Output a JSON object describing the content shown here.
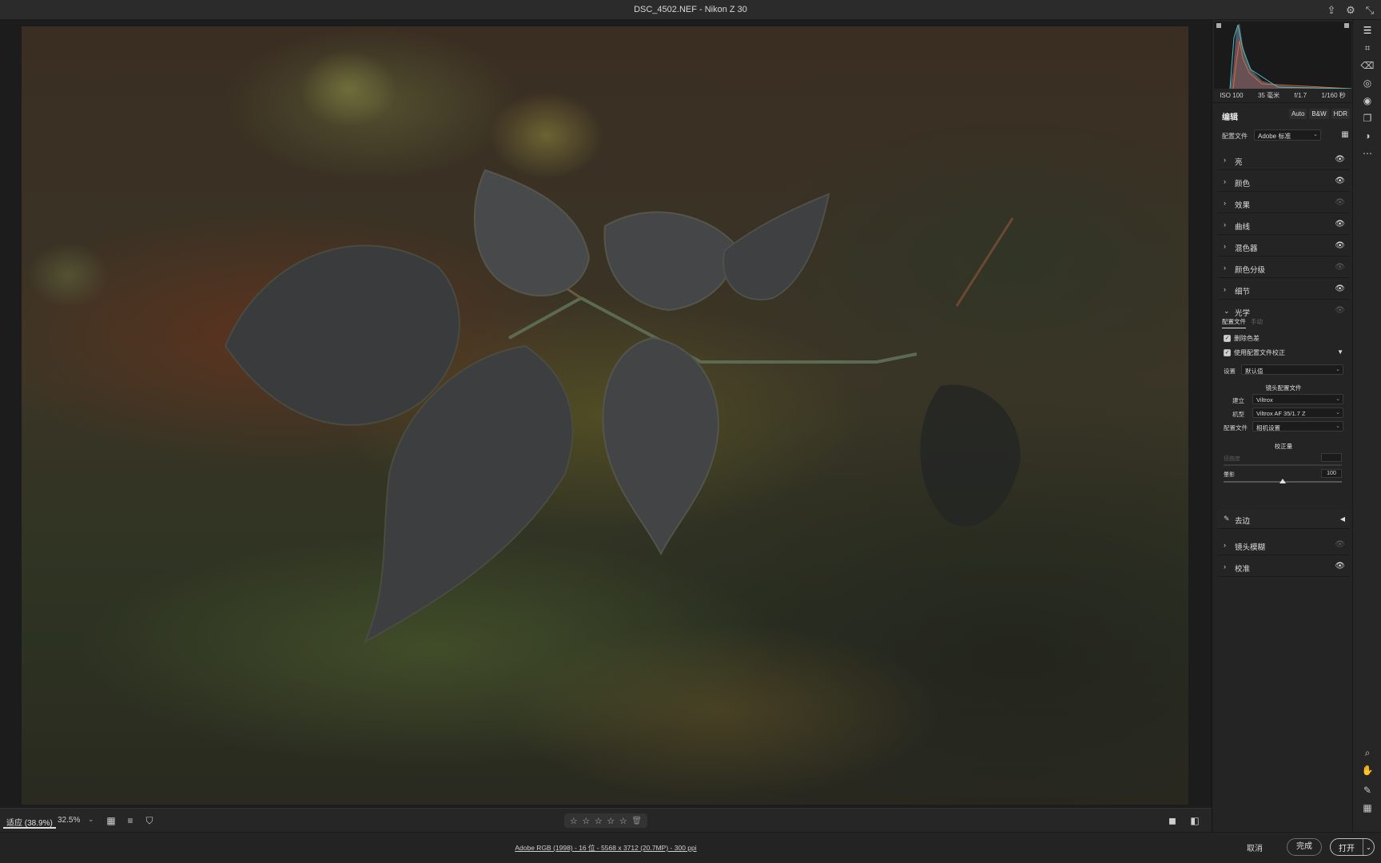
{
  "window": {
    "title": "DSC_4502.NEF - Nikon Z 30"
  },
  "title_icons": [
    "save-icon",
    "gear-icon",
    "collapse-icon"
  ],
  "exif": {
    "iso": "ISO 100",
    "focal": "35 毫米",
    "aperture": "f/1.7",
    "shutter": "1/160 秒"
  },
  "edit": {
    "title": "编辑",
    "modes": [
      "Auto",
      "B&W",
      "HDR"
    ],
    "profile_label": "配置文件",
    "profile_value": "Adobe 标准"
  },
  "sections": [
    {
      "label": "亮",
      "visible": true
    },
    {
      "label": "颜色",
      "visible": true
    },
    {
      "label": "效果",
      "visible": false
    },
    {
      "label": "曲线",
      "visible": true
    },
    {
      "label": "混色器",
      "visible": true
    },
    {
      "label": "颜色分级",
      "visible": false
    },
    {
      "label": "细节",
      "visible": true
    }
  ],
  "optics": {
    "label": "光学",
    "tabs": [
      "配置文件",
      "手动"
    ],
    "remove_ca": "删除色差",
    "use_profile": "使用配置文件校正",
    "setup_label": "设置",
    "setup_value": "默认值",
    "lens_profile_head": "镜头配置文件",
    "make_label": "建立",
    "make_value": "Viltrox",
    "model_label": "机型",
    "model_value": "Viltrox AF 35/1.7 Z",
    "profile_label": "配置文件",
    "profile_value": "相机设置",
    "amount_head": "校正量",
    "distortion_label": "扭曲度",
    "vignetting_label": "暈影",
    "vignetting_value": "100",
    "vignetting_level": 0.5,
    "defringe_label": "去边"
  },
  "sections_after": [
    {
      "label": "镜头模糊",
      "visible": false
    },
    {
      "label": "校准",
      "visible": true
    }
  ],
  "bottom": {
    "zoom_fit": "适应 (38.9%)",
    "zoom_pct": "32.5%",
    "rating_stars": [
      "☆",
      "☆",
      "☆",
      "☆",
      "☆"
    ]
  },
  "status": {
    "info": "Adobe RGB (1998) - 16 位 - 5568 x 3712 (20.7MP) - 300 ppi",
    "cancel": "取消",
    "done": "完成",
    "open": "打开"
  },
  "tools": [
    "edit-icon",
    "crop-icon",
    "heal-icon",
    "mask-icon",
    "redeye-icon",
    "presets-icon",
    "snapshot-icon",
    "more-icon",
    "zoom-icon",
    "hand-icon",
    "sampler-icon",
    "grid-icon"
  ],
  "colors": {
    "panel_bg": "#242424",
    "canvas_bg": "#1c1c1c",
    "accent": "#e0e0e0"
  }
}
